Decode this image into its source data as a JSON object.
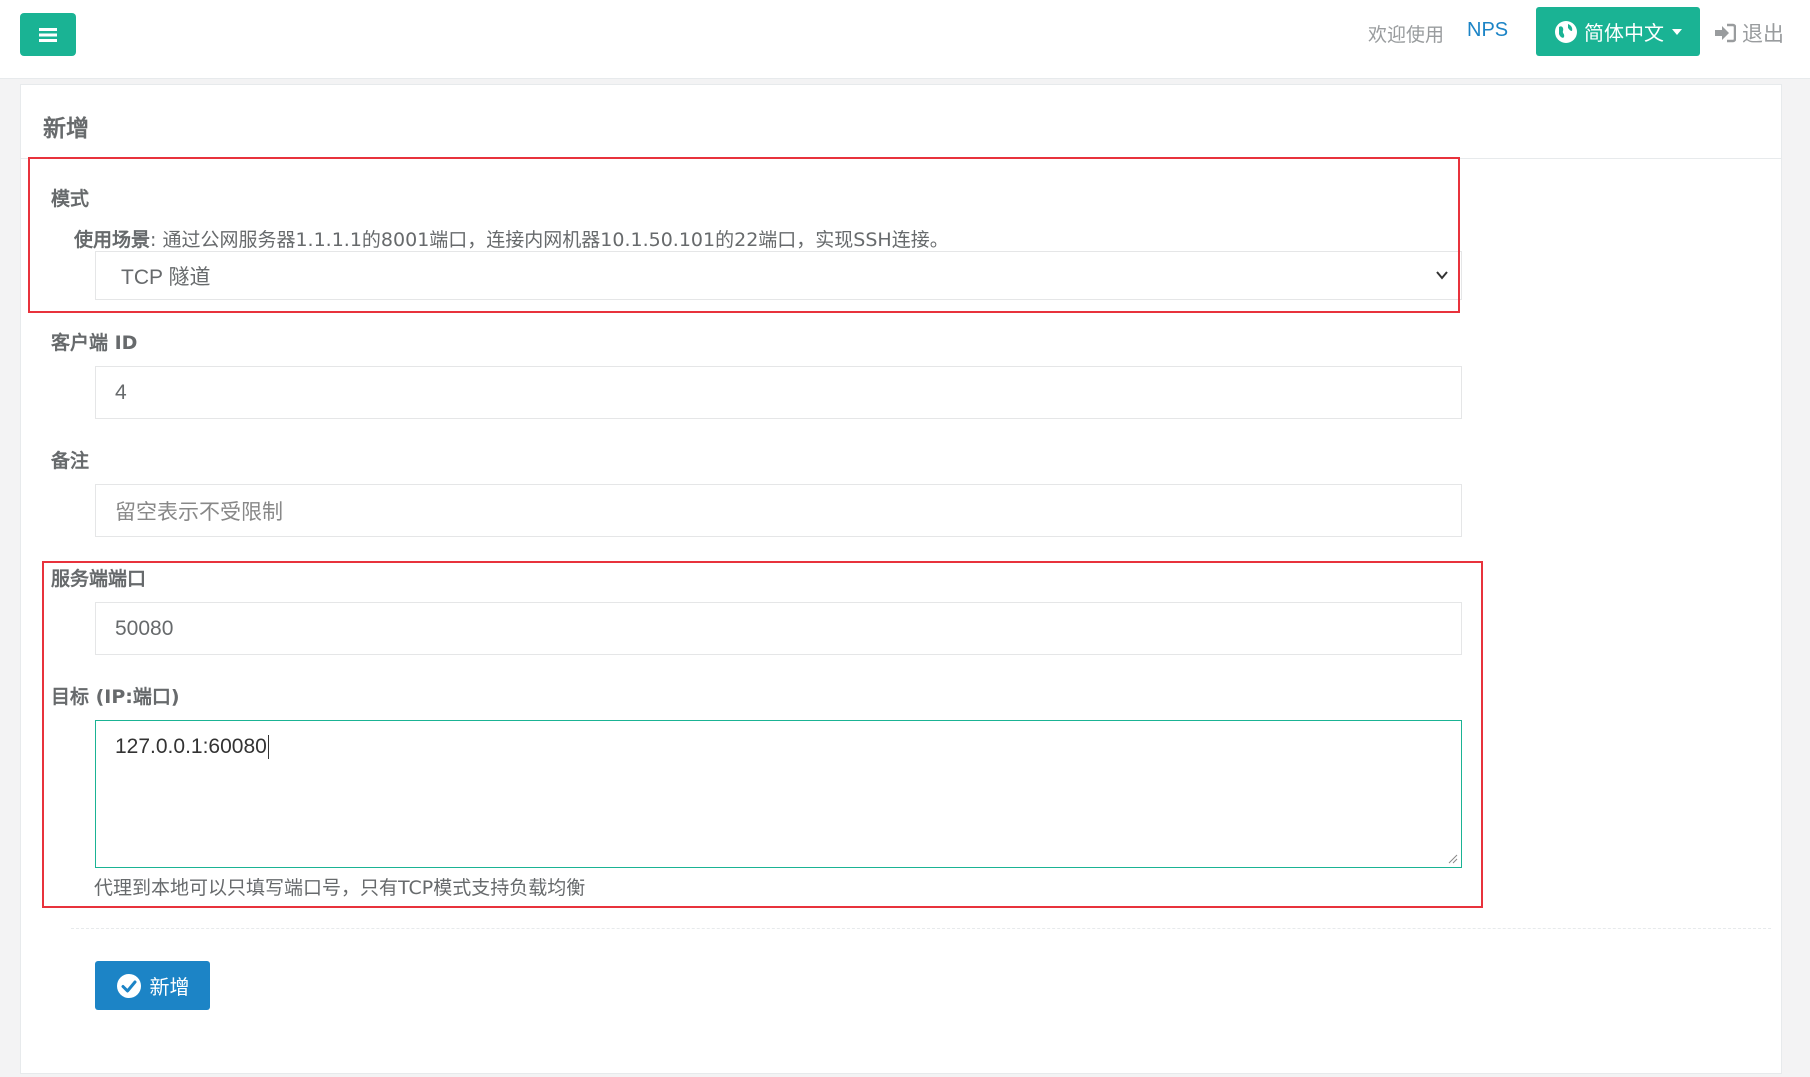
{
  "header": {
    "welcome": "欢迎使用",
    "brand": "NPS",
    "language_button": "简体中文",
    "logout": "退出",
    "icons": {
      "menu": "bars-icon",
      "language": "globe-icon",
      "logout": "sign-out-icon"
    }
  },
  "form": {
    "title": "新增",
    "mode_label": "模式",
    "usage_label": "使用场景",
    "usage_text": ": 通过公网服务器1.1.1.1的8001端口，连接内网机器10.1.50.101的22端口，实现SSH连接。",
    "mode_selected": "TCP 隧道",
    "client_id_label": "客户端 ID",
    "client_id_value": "4",
    "remark_label": "备注",
    "remark_placeholder": "留空表示不受限制",
    "server_port_label": "服务端端口",
    "server_port_value": "50080",
    "target_label": "目标 (IP:端口)",
    "target_value": "127.0.0.1:60080",
    "target_help": "代理到本地可以只填写端口号，只有TCP模式支持负载均衡",
    "submit_label": "新增"
  },
  "colors": {
    "primary": "#1ab394",
    "blue": "#1c84c6",
    "highlight_box": "#e8323c",
    "background": "#f3f3f4"
  }
}
